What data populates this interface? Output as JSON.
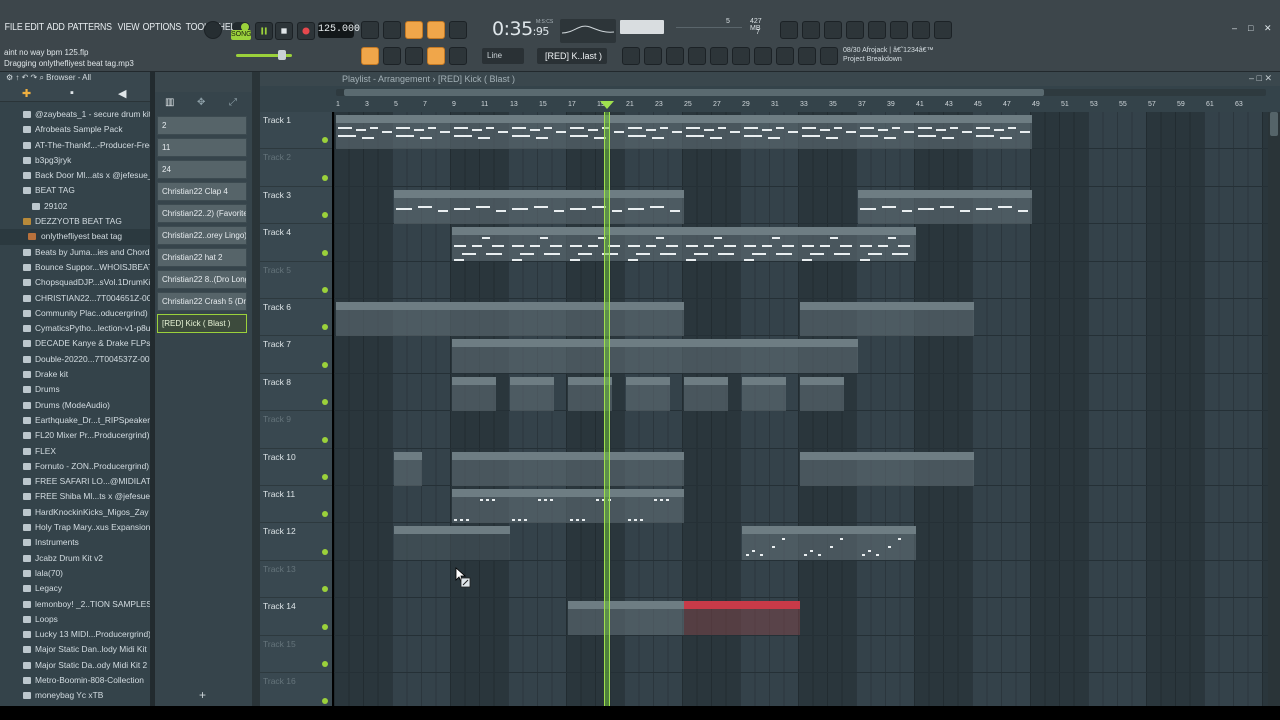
{
  "menu": [
    "FILE",
    "EDIT",
    "ADD",
    "PATTERNS",
    "VIEW",
    "OPTIONS",
    "TOOLS",
    "HELP"
  ],
  "hint": {
    "line1": "aint no way bpm 125.flp",
    "line2": "Dragging onlythefliyest beat tag.mp3"
  },
  "transport": {
    "song_label": "SONG",
    "tempo": "125.000",
    "time_main": "0:35",
    "time_sub": "95",
    "time_unit": "M:S:CS"
  },
  "monitor": {
    "cpu": "5",
    "mem": "427 MB",
    "poly": "7"
  },
  "toolbar": {
    "mode": "Line",
    "pattern": "[RED] K..last )"
  },
  "news": {
    "line1": "08/30  Afrojack | â€˜1234â€™",
    "line2": "Project Breakdown"
  },
  "browser": {
    "title": "Browser - All",
    "items": [
      {
        "label": "@zaybeats_1 - secure drum kit",
        "type": "folder"
      },
      {
        "label": "Afrobeats Sample Pack",
        "type": "folder"
      },
      {
        "label": "AT-The-Thankf...-Producer-Free",
        "type": "folder"
      },
      {
        "label": "b3pg3jryk",
        "type": "folder"
      },
      {
        "label": "Back Door Ml...ats x @jefesue_",
        "type": "folder"
      },
      {
        "label": "BEAT TAG",
        "type": "folder"
      },
      {
        "label": "29102",
        "type": "sub"
      },
      {
        "label": "DEZZYOTB BEAT TAG",
        "type": "tag"
      },
      {
        "label": "onlythefliyest beat tag",
        "type": "file"
      },
      {
        "label": "Beats by Juma...ies and Chords",
        "type": "folder"
      },
      {
        "label": "Bounce Suppor...WHOISJBEATS",
        "type": "folder"
      },
      {
        "label": "ChopsquadDJP...sVol.1DrumKit",
        "type": "folder"
      },
      {
        "label": "CHRISTIAN22...7T004651Z-001",
        "type": "folder"
      },
      {
        "label": "Community Plac..oducergrind)",
        "type": "folder"
      },
      {
        "label": "CymaticsPytho...lection-v1-p8u",
        "type": "folder"
      },
      {
        "label": "DECADE Kanye & Drake FLPs",
        "type": "folder"
      },
      {
        "label": "Double-20220...7T004537Z-001",
        "type": "folder"
      },
      {
        "label": "Drake kit",
        "type": "folder"
      },
      {
        "label": "Drums",
        "type": "folder"
      },
      {
        "label": "Drums (ModeAudio)",
        "type": "folder"
      },
      {
        "label": "Earthquake_Dr...t_RIPSpeakers",
        "type": "folder"
      },
      {
        "label": "FL20 Mixer Pr...Producergrind)",
        "type": "folder"
      },
      {
        "label": "FLEX",
        "type": "folder"
      },
      {
        "label": "Fornuto - ZON..Producergrind)",
        "type": "folder"
      },
      {
        "label": "FREE SAFARI LO...@MIDILATINO",
        "type": "folder"
      },
      {
        "label": "FREE Shiba Ml...ts x @jefesue_",
        "type": "folder"
      },
      {
        "label": "HardKnockinKicks_Migos_Zay",
        "type": "folder"
      },
      {
        "label": "Holy Trap Mary..xus Expansion",
        "type": "folder"
      },
      {
        "label": "Instruments",
        "type": "folder"
      },
      {
        "label": "Jcabz Drum Kit v2",
        "type": "folder"
      },
      {
        "label": "lala(70)",
        "type": "folder"
      },
      {
        "label": "Legacy",
        "type": "folder"
      },
      {
        "label": "lemonboy! _2..TION SAMPLES]",
        "type": "folder"
      },
      {
        "label": "Loops",
        "type": "folder"
      },
      {
        "label": "Lucky 13 MIDI...Producergrind)",
        "type": "folder"
      },
      {
        "label": "Major Static Dan..lody Midi Kit",
        "type": "folder"
      },
      {
        "label": "Major Static Da..ody Midi Kit 2",
        "type": "folder"
      },
      {
        "label": "Metro-Boomin-808-Collection",
        "type": "folder"
      },
      {
        "label": "moneybag Yc xTB",
        "type": "folder"
      }
    ]
  },
  "picker": [
    "2",
    "11",
    "24",
    "Christian22 Clap 4",
    "Christian22..2) (Favorite",
    "Christian22..orey Lingo)",
    "Christian22 hat 2",
    "Christian22 8..(Dro Long",
    "Christian22 Crash 5 (Dro",
    "[RED] Kick ( Blast )"
  ],
  "playlist": {
    "title": "Playlist - Arrangement › [RED] Kick ( Blast )",
    "bars": [
      "1",
      "3",
      "5",
      "7",
      "9",
      "11",
      "13",
      "15",
      "17",
      "19",
      "21",
      "23",
      "25",
      "27",
      "29",
      "31",
      "33",
      "35",
      "37",
      "39",
      "41",
      "43",
      "45",
      "47",
      "49",
      "51",
      "53",
      "55",
      "57",
      "59",
      "61",
      "63"
    ],
    "tracks": [
      "Track 1",
      "Track 2",
      "Track 3",
      "Track 4",
      "Track 5",
      "Track 6",
      "Track 7",
      "Track 8",
      "Track 9",
      "Track 10",
      "Track 11",
      "Track 12",
      "Track 13",
      "Track 14",
      "Track 15",
      "Track 16"
    ],
    "empty_tracks": [
      2,
      5,
      9,
      13,
      15,
      16
    ]
  },
  "clips": {
    "t1": "2",
    "t3": "11",
    "t4": "24",
    "t6": "Christia..Clap 4",
    "t7": "Christia..avorite",
    "t8": "Chris..ngo",
    "t10": "Christi..22 hat 2",
    "t10a": "Chr..2",
    "t11": "Christia..Long",
    "t14": "[RED] Ki..Blast",
    "t14r": "[RED] Ki..Blast"
  }
}
